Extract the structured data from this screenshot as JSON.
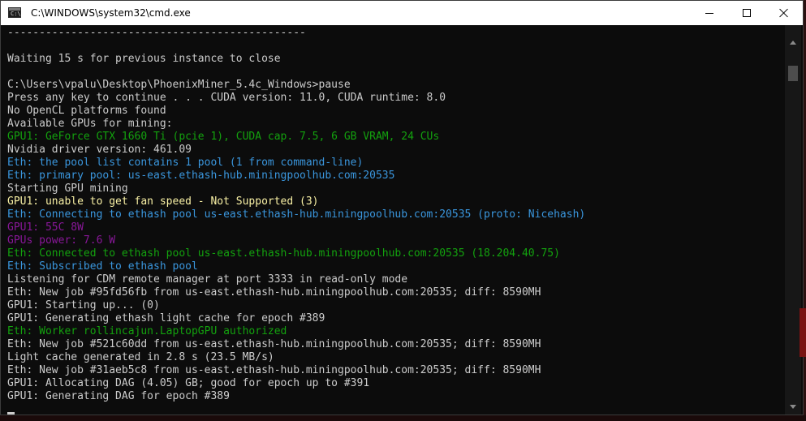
{
  "window": {
    "title": "C:\\WINDOWS\\system32\\cmd.exe",
    "icon_label": "C:\\"
  },
  "console": {
    "lines": [
      {
        "text": "-----------------------------------------------",
        "color": "white"
      },
      {
        "text": "",
        "color": "white"
      },
      {
        "text": "Waiting 15 s for previous instance to close",
        "color": "white"
      },
      {
        "text": "",
        "color": "white"
      },
      {
        "text": "C:\\Users\\vpalu\\Desktop\\PhoenixMiner_5.4c_Windows>pause",
        "color": "white"
      },
      {
        "text": "Press any key to continue . . . CUDA version: 11.0, CUDA runtime: 8.0",
        "color": "white"
      },
      {
        "text": "No OpenCL platforms found",
        "color": "white"
      },
      {
        "text": "Available GPUs for mining:",
        "color": "white"
      },
      {
        "text": "GPU1: GeForce GTX 1660 Ti (pcie 1), CUDA cap. 7.5, 6 GB VRAM, 24 CUs",
        "color": "green"
      },
      {
        "text": "Nvidia driver version: 461.09",
        "color": "white"
      },
      {
        "text": "Eth: the pool list contains 1 pool (1 from command-line)",
        "color": "cyan"
      },
      {
        "text": "Eth: primary pool: us-east.ethash-hub.miningpoolhub.com:20535",
        "color": "cyan"
      },
      {
        "text": "Starting GPU mining",
        "color": "white"
      },
      {
        "text": "GPU1: unable to get fan speed - Not Supported (3)",
        "color": "yellow"
      },
      {
        "text": "Eth: Connecting to ethash pool us-east.ethash-hub.miningpoolhub.com:20535 (proto: Nicehash)",
        "color": "cyan"
      },
      {
        "text": "GPU1: 55C 8W",
        "color": "magenta"
      },
      {
        "text": "GPUs power: 7.6 W",
        "color": "magenta"
      },
      {
        "text": "Eth: Connected to ethash pool us-east.ethash-hub.miningpoolhub.com:20535 (18.204.40.75)",
        "color": "green"
      },
      {
        "text": "Eth: Subscribed to ethash pool",
        "color": "cyan"
      },
      {
        "text": "Listening for CDM remote manager at port 3333 in read-only mode",
        "color": "white"
      },
      {
        "text": "Eth: New job #95fd56fb from us-east.ethash-hub.miningpoolhub.com:20535; diff: 8590MH",
        "color": "white"
      },
      {
        "text": "GPU1: Starting up... (0)",
        "color": "white"
      },
      {
        "text": "GPU1: Generating ethash light cache for epoch #389",
        "color": "white"
      },
      {
        "text": "Eth: Worker rollincajun.LaptopGPU authorized",
        "color": "green"
      },
      {
        "text": "Eth: New job #521c60dd from us-east.ethash-hub.miningpoolhub.com:20535; diff: 8590MH",
        "color": "white"
      },
      {
        "text": "Light cache generated in 2.8 s (23.5 MB/s)",
        "color": "white"
      },
      {
        "text": "Eth: New job #31aeb5c8 from us-east.ethash-hub.miningpoolhub.com:20535; diff: 8590MH",
        "color": "white"
      },
      {
        "text": "GPU1: Allocating DAG (4.05) GB; good for epoch up to #391",
        "color": "white"
      },
      {
        "text": "GPU1: Generating DAG for epoch #389",
        "color": "white"
      }
    ]
  },
  "colors": {
    "console_bg": "#0c0c0c",
    "white": "#cccccc",
    "green": "#13a10e",
    "cyan": "#3a96dd",
    "yellow": "#f9f1a5",
    "magenta": "#881798"
  },
  "icons": {
    "app": "cmd-icon",
    "minimize": "minimize-icon",
    "maximize": "maximize-icon",
    "close": "close-icon"
  }
}
